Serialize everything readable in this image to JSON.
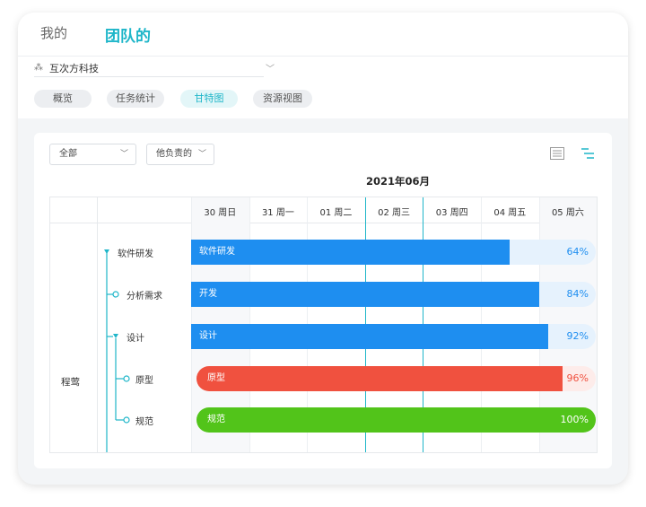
{
  "tabs": {
    "mine": "我的",
    "team": "团队的"
  },
  "org": {
    "name": "互次方科技"
  },
  "view_tabs": [
    "概览",
    "任务统计",
    "甘特图",
    "资源视图"
  ],
  "filters": {
    "scope": "全部",
    "owner": "他负责的"
  },
  "gantt": {
    "month": "2021年06月",
    "days": [
      "30 周日",
      "31 周一",
      "01 周二",
      "02 周三",
      "03 周四",
      "04 周五",
      "05 周六"
    ],
    "person": "程莺",
    "tasks": [
      {
        "label": "软件研发",
        "bar_label": "软件研发",
        "percent_text": "64%",
        "progress": 0.64,
        "color": "#1e8ef0"
      },
      {
        "label": "分析需求",
        "bar_label": "开发",
        "percent_text": "84%",
        "progress": 0.84,
        "color": "#1e8ef0"
      },
      {
        "label": "设计",
        "bar_label": "设计",
        "percent_text": "92%",
        "progress": 0.92,
        "color": "#1e8ef0"
      },
      {
        "label": "原型",
        "bar_label": "原型",
        "percent_text": "96%",
        "progress": 0.96,
        "color": "#f0513f"
      },
      {
        "label": "规范",
        "bar_label": "规范",
        "percent_text": "100%",
        "progress": 1.0,
        "color": "#52c41a"
      }
    ]
  },
  "colors": {
    "accent": "#1fb6c9",
    "blue": "#1e8ef0",
    "red": "#f0513f",
    "green": "#52c41a"
  }
}
